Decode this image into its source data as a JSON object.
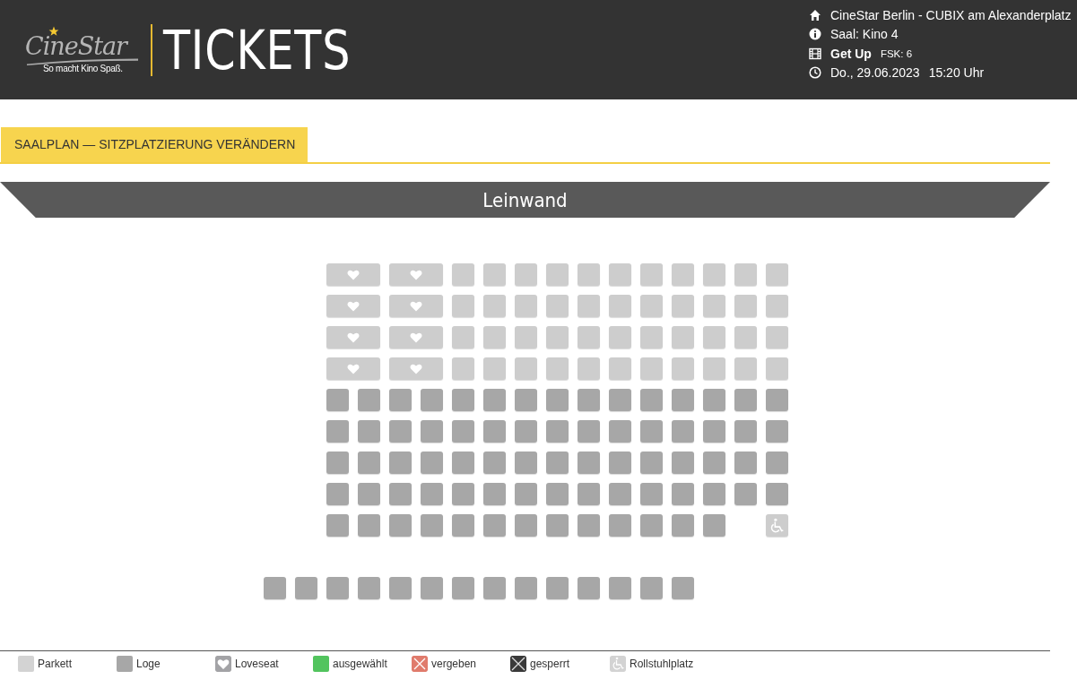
{
  "header": {
    "logo": {
      "brand": "CineStar",
      "slogan": "So macht Kino Spaß."
    },
    "title": "TICKETS",
    "info": [
      {
        "kind": "cinema",
        "text": "CineStar Berlin - CUBIX am Alexanderplatz"
      },
      {
        "kind": "hall",
        "text": "Saal: Kino 4"
      },
      {
        "kind": "movie",
        "text": "Get Up",
        "extra": "FSK: 6"
      },
      {
        "kind": "time",
        "text": "Do., 29.06.2023",
        "extra": "15:20 Uhr"
      }
    ]
  },
  "tab": {
    "label": "SAALPLAN — SITZPLATZIERUNG VERÄNDERN"
  },
  "screen": {
    "label": "Leinwand"
  },
  "seat_rows": [
    {
      "seats": [
        {
          "kind": "empty"
        },
        {
          "kind": "empty"
        },
        {
          "kind": "loveseat"
        },
        {
          "kind": "loveseat"
        },
        {
          "kind": "parkett"
        },
        {
          "kind": "parkett"
        },
        {
          "kind": "parkett"
        },
        {
          "kind": "parkett"
        },
        {
          "kind": "parkett"
        },
        {
          "kind": "parkett"
        },
        {
          "kind": "parkett"
        },
        {
          "kind": "parkett"
        },
        {
          "kind": "parkett"
        },
        {
          "kind": "parkett"
        },
        {
          "kind": "parkett"
        }
      ]
    },
    {
      "seats": [
        {
          "kind": "empty"
        },
        {
          "kind": "empty"
        },
        {
          "kind": "loveseat"
        },
        {
          "kind": "loveseat"
        },
        {
          "kind": "parkett"
        },
        {
          "kind": "parkett"
        },
        {
          "kind": "parkett"
        },
        {
          "kind": "parkett"
        },
        {
          "kind": "parkett"
        },
        {
          "kind": "parkett"
        },
        {
          "kind": "parkett"
        },
        {
          "kind": "parkett"
        },
        {
          "kind": "parkett"
        },
        {
          "kind": "parkett"
        },
        {
          "kind": "parkett"
        }
      ]
    },
    {
      "seats": [
        {
          "kind": "empty"
        },
        {
          "kind": "empty"
        },
        {
          "kind": "loveseat"
        },
        {
          "kind": "loveseat"
        },
        {
          "kind": "parkett"
        },
        {
          "kind": "parkett"
        },
        {
          "kind": "parkett"
        },
        {
          "kind": "parkett"
        },
        {
          "kind": "parkett"
        },
        {
          "kind": "parkett"
        },
        {
          "kind": "parkett"
        },
        {
          "kind": "parkett"
        },
        {
          "kind": "parkett"
        },
        {
          "kind": "parkett"
        },
        {
          "kind": "parkett"
        }
      ]
    },
    {
      "seats": [
        {
          "kind": "empty"
        },
        {
          "kind": "empty"
        },
        {
          "kind": "loveseat"
        },
        {
          "kind": "loveseat"
        },
        {
          "kind": "parkett"
        },
        {
          "kind": "parkett"
        },
        {
          "kind": "parkett"
        },
        {
          "kind": "parkett"
        },
        {
          "kind": "parkett"
        },
        {
          "kind": "parkett"
        },
        {
          "kind": "parkett"
        },
        {
          "kind": "parkett"
        },
        {
          "kind": "parkett"
        },
        {
          "kind": "parkett"
        },
        {
          "kind": "parkett"
        }
      ]
    },
    {
      "seats": [
        {
          "kind": "empty"
        },
        {
          "kind": "empty"
        },
        {
          "kind": "loge"
        },
        {
          "kind": "loge"
        },
        {
          "kind": "loge"
        },
        {
          "kind": "loge"
        },
        {
          "kind": "loge"
        },
        {
          "kind": "loge"
        },
        {
          "kind": "loge"
        },
        {
          "kind": "loge"
        },
        {
          "kind": "loge"
        },
        {
          "kind": "loge"
        },
        {
          "kind": "loge"
        },
        {
          "kind": "loge"
        },
        {
          "kind": "loge"
        },
        {
          "kind": "loge"
        },
        {
          "kind": "loge"
        }
      ]
    },
    {
      "seats": [
        {
          "kind": "empty"
        },
        {
          "kind": "empty"
        },
        {
          "kind": "loge"
        },
        {
          "kind": "loge"
        },
        {
          "kind": "loge"
        },
        {
          "kind": "loge"
        },
        {
          "kind": "loge"
        },
        {
          "kind": "loge"
        },
        {
          "kind": "loge"
        },
        {
          "kind": "loge"
        },
        {
          "kind": "loge"
        },
        {
          "kind": "loge"
        },
        {
          "kind": "loge"
        },
        {
          "kind": "loge"
        },
        {
          "kind": "loge"
        },
        {
          "kind": "loge"
        },
        {
          "kind": "loge"
        }
      ]
    },
    {
      "seats": [
        {
          "kind": "empty"
        },
        {
          "kind": "empty"
        },
        {
          "kind": "loge"
        },
        {
          "kind": "loge"
        },
        {
          "kind": "loge"
        },
        {
          "kind": "loge"
        },
        {
          "kind": "loge"
        },
        {
          "kind": "loge"
        },
        {
          "kind": "loge"
        },
        {
          "kind": "loge"
        },
        {
          "kind": "loge"
        },
        {
          "kind": "loge"
        },
        {
          "kind": "loge"
        },
        {
          "kind": "loge"
        },
        {
          "kind": "loge"
        },
        {
          "kind": "loge"
        },
        {
          "kind": "loge"
        }
      ]
    },
    {
      "seats": [
        {
          "kind": "empty"
        },
        {
          "kind": "empty"
        },
        {
          "kind": "loge"
        },
        {
          "kind": "loge"
        },
        {
          "kind": "loge"
        },
        {
          "kind": "loge"
        },
        {
          "kind": "loge"
        },
        {
          "kind": "loge"
        },
        {
          "kind": "loge"
        },
        {
          "kind": "loge"
        },
        {
          "kind": "loge"
        },
        {
          "kind": "loge"
        },
        {
          "kind": "loge"
        },
        {
          "kind": "loge"
        },
        {
          "kind": "loge"
        },
        {
          "kind": "loge"
        },
        {
          "kind": "loge"
        }
      ]
    },
    {
      "seats": [
        {
          "kind": "empty"
        },
        {
          "kind": "empty"
        },
        {
          "kind": "loge"
        },
        {
          "kind": "loge"
        },
        {
          "kind": "loge"
        },
        {
          "kind": "loge"
        },
        {
          "kind": "loge"
        },
        {
          "kind": "loge"
        },
        {
          "kind": "loge"
        },
        {
          "kind": "loge"
        },
        {
          "kind": "loge"
        },
        {
          "kind": "loge"
        },
        {
          "kind": "loge"
        },
        {
          "kind": "loge"
        },
        {
          "kind": "loge"
        },
        {
          "kind": "empty"
        },
        {
          "kind": "wheelchair"
        }
      ]
    },
    {
      "kind": "aisle"
    },
    {
      "seats": [
        {
          "kind": "loge"
        },
        {
          "kind": "loge"
        },
        {
          "kind": "loge"
        },
        {
          "kind": "loge"
        },
        {
          "kind": "loge"
        },
        {
          "kind": "loge"
        },
        {
          "kind": "loge"
        },
        {
          "kind": "loge"
        },
        {
          "kind": "loge"
        },
        {
          "kind": "loge"
        },
        {
          "kind": "loge"
        },
        {
          "kind": "loge"
        },
        {
          "kind": "loge"
        },
        {
          "kind": "loge"
        }
      ]
    }
  ],
  "legend": [
    {
      "kind": "parkett",
      "label": "Parkett"
    },
    {
      "kind": "loge",
      "label": "Loge"
    },
    {
      "kind": "loveseat",
      "label": "Loveseat"
    },
    {
      "kind": "selected",
      "label": "ausgewählt"
    },
    {
      "kind": "taken",
      "label": "vergeben"
    },
    {
      "kind": "blocked",
      "label": "gesperrt"
    },
    {
      "kind": "wheelchair",
      "label": "Rollstuhlplatz"
    }
  ]
}
